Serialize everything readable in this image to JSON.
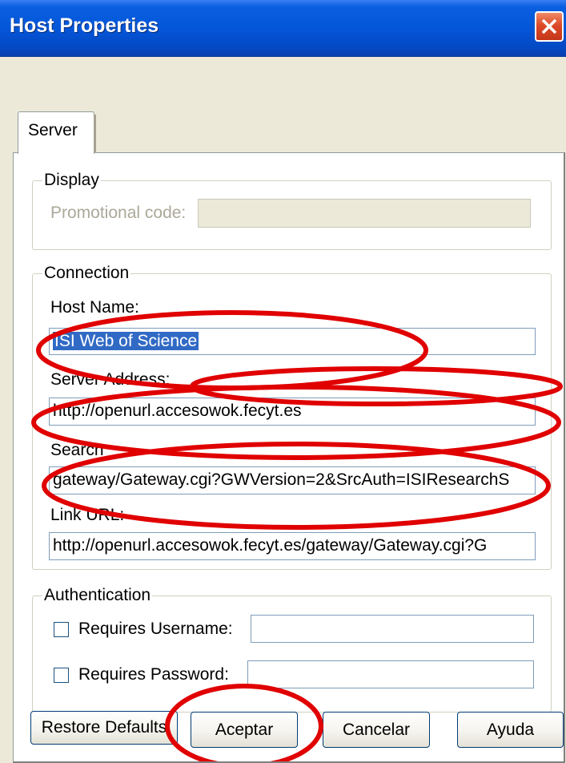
{
  "window": {
    "title": "Host Properties"
  },
  "tabs": [
    {
      "label": "Server"
    }
  ],
  "display_group": {
    "legend": "Display",
    "promo_label": "Promotional code:",
    "promo_value": ""
  },
  "connection_group": {
    "legend": "Connection",
    "host_name_label": "Host Name:",
    "host_name_value": "ISI Web of Science",
    "server_address_label": "Server Address:",
    "server_address_value": "http://openurl.accesowok.fecyt.es",
    "search_label": "Search",
    "search_value": "gateway/Gateway.cgi?GWVersion=2&SrcAuth=ISIResearchS",
    "link_url_label": "Link URL:",
    "link_url_value": "http://openurl.accesowok.fecyt.es/gateway/Gateway.cgi?G"
  },
  "auth_group": {
    "legend": "Authentication",
    "username_label": "Requires Username:",
    "username_checked": false,
    "username_value": "",
    "password_label": "Requires Password:",
    "password_checked": false,
    "password_value": ""
  },
  "buttons": {
    "restore_defaults": "Restore Defaults",
    "ok": "Aceptar",
    "cancel": "Cancelar",
    "help": "Ayuda"
  },
  "colors": {
    "title_bar": "#0456d9",
    "dialog_bg": "#ece9d8",
    "selection": "#316ac5",
    "annotation": "#e00000"
  },
  "icons": {
    "close": "close-icon"
  }
}
